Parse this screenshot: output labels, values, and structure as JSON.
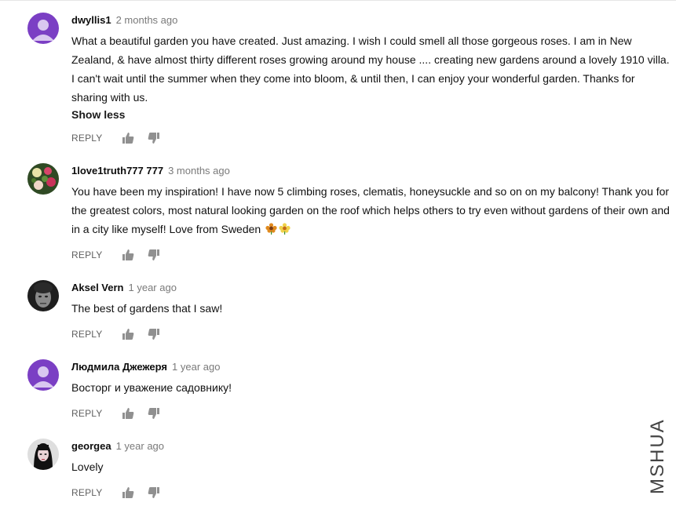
{
  "comments": [
    {
      "author": "dwyllis1",
      "time": "2 months ago",
      "text": "What a beautiful garden you have created. Just amazing. I wish I could smell all those gorgeous roses. I am in New Zealand, & have almost thirty different roses growing around my house .... creating new gardens around a lovely 1910 villa. I can't wait until the summer when they come into bloom, & until then, I can enjoy your wonderful garden. Thanks for sharing with us.",
      "show_less": "Show less",
      "reply": "REPLY",
      "avatar_color": "#7b3fc4"
    },
    {
      "author": "1love1truth777 777",
      "time": "3 months ago",
      "text": "You have been my inspiration! I have now 5 climbing roses, clematis, honeysuckle and so on on my balcony! Thank you for the greatest colors, most natural looking garden on the roof which helps others to try even without gardens of their own and in a city like myself! Love from Sweden",
      "emoji": [
        "flower-icon",
        "flower-icon"
      ],
      "reply": "REPLY"
    },
    {
      "author": "Aksel Vern",
      "time": "1 year ago",
      "text": "The best of gardens that I saw!",
      "reply": "REPLY"
    },
    {
      "author": "Людмила Джежеря",
      "time": "1 year ago",
      "text": "Восторг и уважение садовнику!",
      "reply": "REPLY",
      "avatar_color": "#7b3fc4"
    },
    {
      "author": "georgea",
      "time": "1 year ago",
      "text": "Lovely",
      "reply": "REPLY"
    }
  ],
  "icons": {
    "like": "thumb-up-icon",
    "dislike": "thumb-down-icon"
  },
  "watermark": "MSHUA",
  "colors": {
    "author": "#0d0d0d",
    "meta": "#7a7a7a",
    "action": "#606060",
    "default_avatar": "#7b3fc4"
  }
}
